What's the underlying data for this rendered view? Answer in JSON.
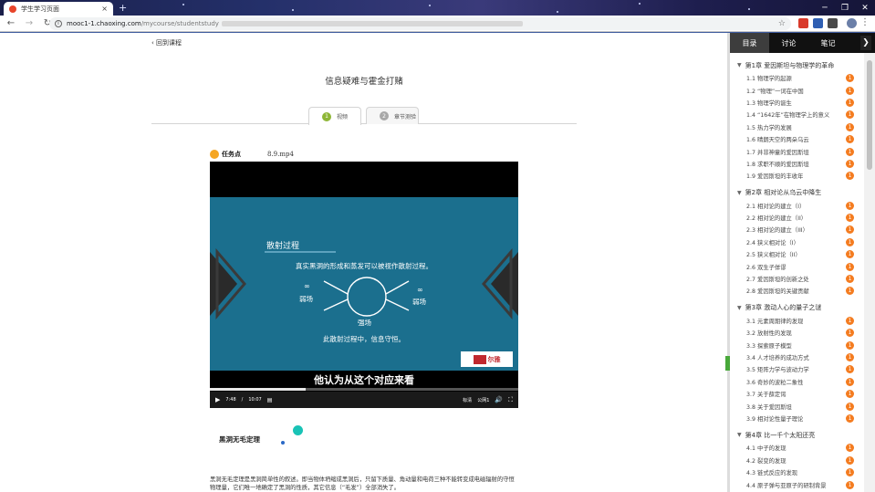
{
  "browser": {
    "tab_title": "学生学习页面",
    "tab_close": "×",
    "new_tab": "+",
    "url_domain": "mooc1-1.chaoxing.com",
    "url_path": "/mycourse/studentstudy"
  },
  "header": {
    "back_label": "回到课程",
    "title": "信息疑难与霍金打赌"
  },
  "view_tabs": [
    {
      "num": "1",
      "label": "视频"
    },
    {
      "num": "2",
      "label": "章节测验"
    }
  ],
  "task": {
    "label": "任务点",
    "file": "8.9.mp4"
  },
  "video": {
    "slide_heading": "散射过程",
    "slide_line1": "真实黑洞的形成和蒸发可以被视作散射过程。",
    "weak_sym": "∞",
    "weak_label": "弱场",
    "strong_label": "强场",
    "slide_line2": "此散射过程中，信息守恒。",
    "logo_text": "尔雅",
    "subtitle": "他认为从这个对应来看",
    "time_current": "7:48",
    "time_sep": "/",
    "time_total": "10:07",
    "quality": "标清",
    "line": "公网1",
    "progress_fraction": 0.31
  },
  "section": {
    "heading": "黑洞无毛定理",
    "paragraph": "黑洞无毛定理是黑洞简单性的叙述。即当物体坍缩成黑洞后，只留下质量、角动量和电荷三种不能转变成电磁辐射的守恒物理量，它们唯一地确定了黑洞的性质，其它信息（“毛发”）全部消失了。"
  },
  "sidebar": {
    "tabs": [
      "目录",
      "讨论",
      "笔记"
    ],
    "arrow": "❯",
    "badge": "1",
    "chapters": [
      {
        "title": "第1章 爱因斯坦与物理学的革命",
        "items": [
          "1.1 物理学的起源",
          "1.2 “物理”一词在中国",
          "1.3 物理学的诞生",
          "1.4 “1642年”在物理学上的意义",
          "1.5 热力学的发展",
          "1.6 晴朗天空的两朵乌云",
          "1.7 并非神童的爱因斯坦",
          "1.8 求职不顺的爱因斯坦",
          "1.9 爱因斯坦的丰收年"
        ]
      },
      {
        "title": "第2章 相对论从乌云中降生",
        "items": [
          "2.1 相对论的建立（I）",
          "2.2 相对论的建立（II）",
          "2.3 相对论的建立（III）",
          "2.4 狭义相对论（I）",
          "2.5 狭义相对论（II）",
          "2.6 双生子佯谬",
          "2.7 爱因斯坦的创新之处",
          "2.8 爱因斯坦的关键贡献"
        ]
      },
      {
        "title": "第3章 激动人心的量子之谜",
        "items": [
          "3.1 元素周期律的发现",
          "3.2 放射性的发现",
          "3.3 探索原子模型",
          "3.4 人才培养的成功方式",
          "3.5 矩阵力学与波动力学",
          "3.6 奇妙的波粒二象性",
          "3.7 关于薛定谔",
          "3.8 关于爱因斯坦",
          "3.9 相对论性量子理论"
        ]
      },
      {
        "title": "第4章 比一千个太阳还亮",
        "items": [
          "4.1 中子的发现",
          "4.2 裂变的发现",
          "4.3 链式反应的发现",
          "4.4 原子弹与亚原子的研制背景"
        ]
      }
    ]
  }
}
